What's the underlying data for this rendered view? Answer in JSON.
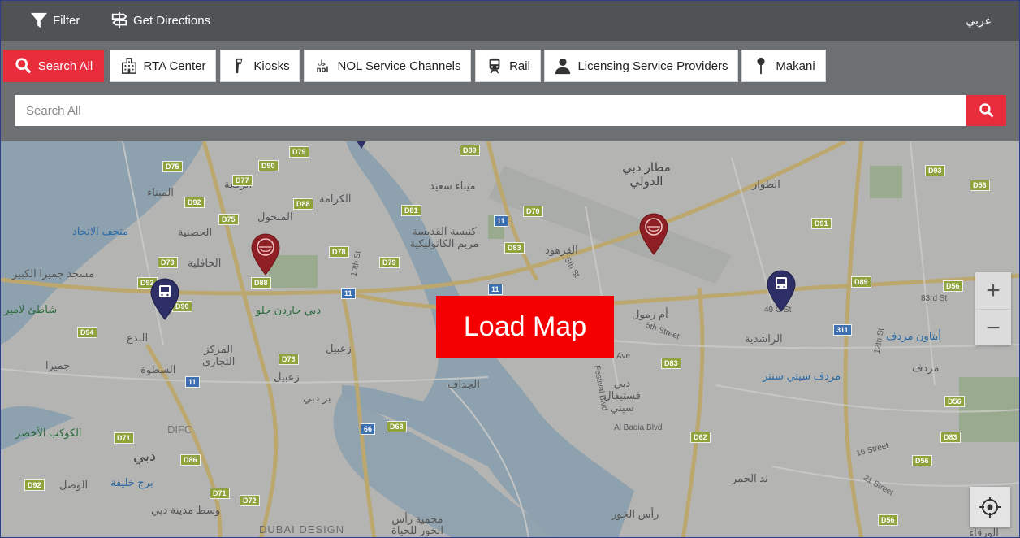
{
  "topbar": {
    "filter_label": "Filter",
    "directions_label": "Get Directions",
    "language_label": "عربي"
  },
  "tabs": [
    {
      "label": "Search All",
      "icon": "search-icon"
    },
    {
      "label": "RTA Center",
      "icon": "building-icon"
    },
    {
      "label": "Kiosks",
      "icon": "kiosk-icon"
    },
    {
      "label": "NOL Service Channels",
      "icon": "nol-icon",
      "icon_text_top": "نول",
      "icon_text_bottom": "nol"
    },
    {
      "label": "Rail",
      "icon": "train-icon"
    },
    {
      "label": "Licensing Service Providers",
      "icon": "person-icon"
    },
    {
      "label": "Makani",
      "icon": "pin-icon"
    }
  ],
  "search": {
    "placeholder": "Search All"
  },
  "map": {
    "load_label": "Load Map",
    "zoom_in": "+",
    "zoom_out": "−",
    "labels": {
      "airport": "مطار دبي الدولي",
      "tawar": "الطوار",
      "ruqqa": "الرقعة",
      "karama": "الكرامة",
      "mina": "الميناء",
      "mankhool": "المنخول",
      "hosn": "الحصنية",
      "ittihad_museum": "متحف الاتحاد",
      "jumeirah_mosque": "مسجد جميرا الكبير",
      "beach": "شاطئ لامير",
      "hafiliya": "الحافلية",
      "garhoud": "القرهود",
      "church": "كنيسة القديسة مريم الكاثوليكية",
      "mina_saeed": "ميناء سعيد",
      "umm_ramool": "أم رمول",
      "rashidiya": "الراشدية",
      "ibtawin": "أيتاون مردف",
      "mirdif": "مردف",
      "mirdif_city": "مردف سيتي سنتر",
      "trade": "المركز التجاري",
      "satwa": "السطوة",
      "bada": "البدع",
      "zabeel": "زعبيل",
      "zabeel2": "زعبيل",
      "bur_dubai": "بر دبي",
      "jaddaf": "الجداف",
      "festival": "دبي فستيفال سيتي",
      "difc": "DIFC",
      "dubai": "دبي",
      "kawkab": "الكوكب الأخضر",
      "burj": "برج خليفة",
      "wasl": "الوصل",
      "downtown": "وسط مدينة دبي",
      "design": "DUBAI DESIGN",
      "sanctuary": "محمية رأس الخور للحياة",
      "ras_khor": "رأس الخور",
      "nad_hamar": "ند الحمر",
      "warqa": "الورقاء",
      "garden": "دبي جاردن جلو",
      "jumeira": "جميرا",
      "st_10th": "10th St",
      "st_5th": "5th St",
      "st_5th_street": "5th Street",
      "st_49": "49 C St",
      "st_12th": "12th St",
      "st_83rd": "83rd St",
      "st_16": "16 Street",
      "st_21": "21 Street",
      "st_12": "12th St",
      "festival_blvd": "Festival Blvd",
      "badia_blvd": "Al Badia Blvd",
      "ave": "Ave"
    },
    "shields": [
      "D79",
      "D75",
      "D90",
      "D77",
      "D92",
      "D88",
      "D75",
      "D73",
      "D92",
      "D90",
      "D94",
      "D78",
      "D79",
      "D81",
      "D70",
      "D83",
      "D88",
      "D73",
      "D83",
      "D62",
      "D68",
      "D71",
      "D86",
      "D92",
      "D71",
      "D72",
      "D91",
      "D93",
      "D56",
      "D56",
      "D56",
      "D56",
      "D83",
      "D56",
      "D89",
      "D89",
      "D73"
    ],
    "route_shields": [
      "11",
      "11",
      "11",
      "11",
      "311",
      "66",
      "11"
    ]
  }
}
